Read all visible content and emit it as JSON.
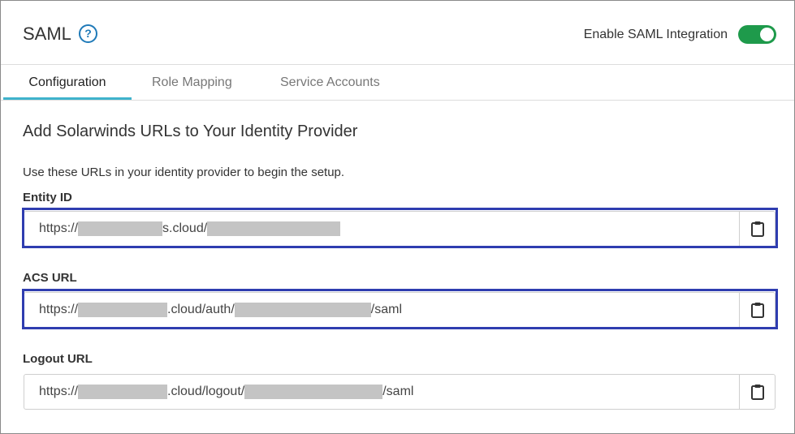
{
  "header": {
    "title": "SAML",
    "help_icon": "question-circle-icon",
    "toggle_label": "Enable SAML Integration",
    "toggle_on": true,
    "accent_color": "#1e9a4b"
  },
  "tabs": [
    {
      "label": "Configuration",
      "active": true
    },
    {
      "label": "Role Mapping",
      "active": false
    },
    {
      "label": "Service Accounts",
      "active": false
    }
  ],
  "section": {
    "title": "Add Solarwinds URLs to Your Identity Provider",
    "description": "Use these URLs in your identity provider to begin the setup."
  },
  "fields": [
    {
      "label": "Entity ID",
      "prefix": "https://",
      "middle": "s.cloud/",
      "suffix": "",
      "copy_icon": "clipboard-icon",
      "highlighted": true
    },
    {
      "label": "ACS URL",
      "prefix": "https://",
      "middle": ".cloud/auth/",
      "suffix": "/saml",
      "copy_icon": "clipboard-icon",
      "highlighted": true
    },
    {
      "label": "Logout URL",
      "prefix": "https://",
      "middle": ".cloud/logout/",
      "suffix": "/saml",
      "copy_icon": "clipboard-icon",
      "highlighted": false
    }
  ],
  "colors": {
    "highlight_border": "#2f3db0",
    "tab_underline": "#3fb3cc",
    "help_icon": "#1f7ab8",
    "redaction": "#c4c4c4"
  }
}
